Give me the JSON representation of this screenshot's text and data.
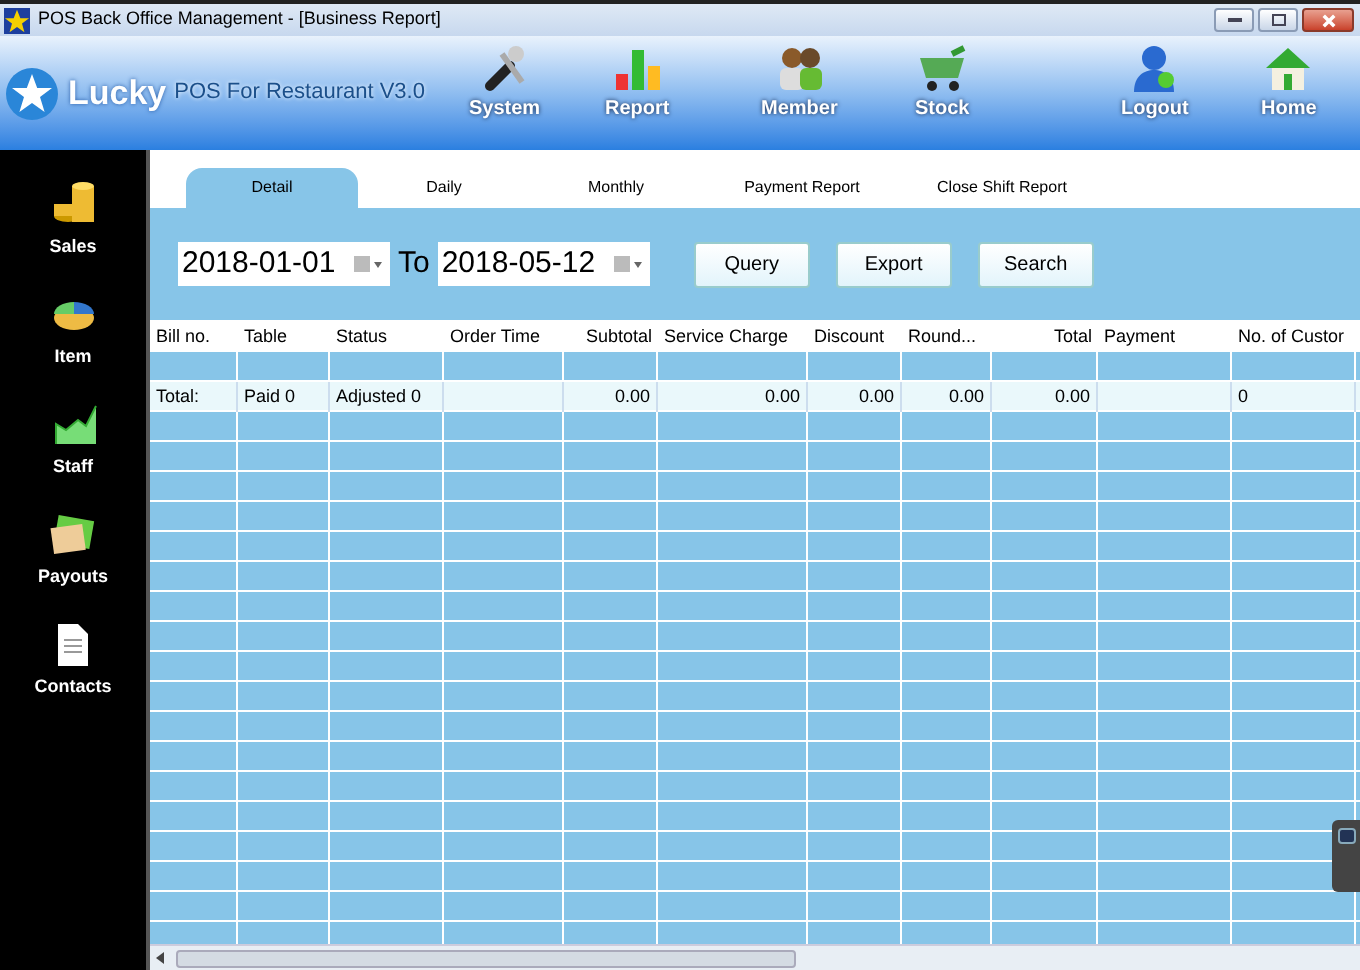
{
  "window": {
    "title": "POS Back Office Management - [Business Report]"
  },
  "header": {
    "brand": "Lucky",
    "product": "POS For Restaurant V3.0",
    "nav": [
      {
        "label": "System",
        "kind": "tools"
      },
      {
        "label": "Report",
        "kind": "chart"
      },
      {
        "label": "Member",
        "kind": "people"
      },
      {
        "label": "Stock",
        "kind": "cart"
      },
      {
        "label": "Logout",
        "kind": "user"
      },
      {
        "label": "Home",
        "kind": "home"
      }
    ]
  },
  "sidebar": {
    "items": [
      {
        "label": "Sales",
        "kind": "coins"
      },
      {
        "label": "Item",
        "kind": "pie"
      },
      {
        "label": "Staff",
        "kind": "area"
      },
      {
        "label": "Payouts",
        "kind": "folder"
      },
      {
        "label": "Contacts",
        "kind": "doc"
      }
    ]
  },
  "tabs": [
    {
      "label": "Detail",
      "selected": true
    },
    {
      "label": "Daily",
      "selected": false
    },
    {
      "label": "Monthly",
      "selected": false
    },
    {
      "label": "Payment Report",
      "selected": false
    },
    {
      "label": "Close Shift Report",
      "selected": false
    }
  ],
  "filter": {
    "from": "2018-01-01",
    "to_label": "To",
    "to": "2018-05-12",
    "buttons": [
      "Query",
      "Export",
      "Search"
    ]
  },
  "table": {
    "columns": [
      "Bill no.",
      "Table",
      "Status",
      "Order Time",
      "Subtotal",
      "Service Charge",
      "Discount",
      "Round...",
      "Total",
      "Payment",
      "No. of Custor"
    ],
    "total_row": {
      "bill_no": "Total:",
      "table": "Paid 0",
      "status": "Adjusted 0",
      "subtotal": "0.00",
      "service_charge": "0.00",
      "discount": "0.00",
      "round": "0.00",
      "total": "0.00",
      "customers": "0"
    }
  }
}
